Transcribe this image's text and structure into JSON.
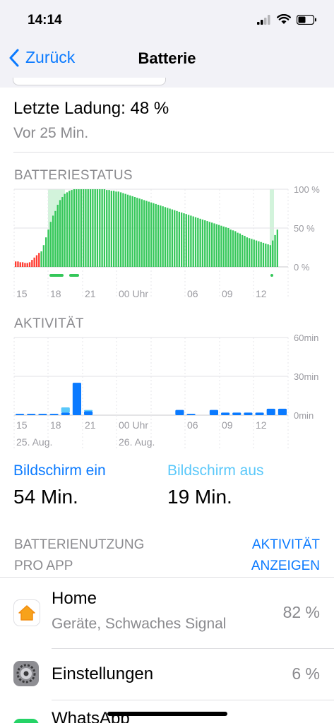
{
  "status": {
    "time": "14:14"
  },
  "nav": {
    "back_label": "Zurück",
    "title": "Batterie"
  },
  "last_charge": {
    "title": "Letzte Ladung: 48 %",
    "subtitle": "Vor 25 Min."
  },
  "battery_status": {
    "label": "BATTERIESTATUS",
    "y_ticks": [
      "100 %",
      "50 %",
      "0 %"
    ],
    "x_ticks": [
      "15",
      "18",
      "21",
      "00 Uhr",
      "06",
      "09",
      "12"
    ]
  },
  "activity": {
    "label": "AKTIVITÄT",
    "y_ticks": [
      "60min",
      "30min",
      "0min"
    ],
    "x_ticks": [
      "15",
      "18",
      "21",
      "00 Uhr",
      "06",
      "09",
      "12"
    ],
    "date_labels": [
      "25. Aug.",
      "26. Aug."
    ]
  },
  "screen": {
    "on_label": "Bildschirm ein",
    "on_value": "54 Min.",
    "off_label": "Bildschirm aus",
    "off_value": "19 Min."
  },
  "usage": {
    "header_line1": "BATTERIENUTZUNG",
    "header_line2": "PRO APP",
    "link_line1": "AKTIVITÄT",
    "link_line2": "ANZEIGEN",
    "apps": [
      {
        "name": "Home",
        "subtitle": "Geräte, Schwaches Signal",
        "percent": "82 %",
        "icon": "home-app-icon"
      },
      {
        "name": "Einstellungen",
        "subtitle": "",
        "percent": "6 %",
        "icon": "settings-app-icon"
      },
      {
        "name": "WhatsApp",
        "subtitle": "",
        "percent": "",
        "icon": "whatsapp-app-icon"
      }
    ]
  },
  "colors": {
    "accent": "#0a7aff",
    "battery_green": "#34c759",
    "battery_low": "#ff3b30",
    "screen_on": "#0a7aff",
    "screen_off": "#5ac8fa"
  },
  "chart_data": [
    {
      "type": "bar",
      "title": "BATTERIESTATUS",
      "ylim": [
        0,
        100
      ],
      "y_unit": "%",
      "x_tick_labels": [
        "15",
        "18",
        "21",
        "00 Uhr",
        "06",
        "09",
        "12"
      ],
      "series": [
        {
          "values": [
            7,
            7,
            6,
            6,
            5,
            5,
            6,
            9,
            12,
            15,
            18,
            20,
            28,
            38,
            48,
            58,
            66,
            72,
            80,
            86,
            90,
            94,
            96,
            98,
            99,
            100,
            100,
            100,
            100,
            100,
            100,
            100,
            100,
            100,
            100,
            100,
            100,
            100,
            100,
            99,
            99,
            98,
            98,
            97,
            97,
            96,
            95,
            94,
            93,
            92,
            91,
            90,
            89,
            88,
            87,
            86,
            85,
            84,
            83,
            82,
            81,
            80,
            79,
            78,
            77,
            76,
            75,
            74,
            73,
            72,
            71,
            70,
            69,
            68,
            67,
            66,
            65,
            64,
            63,
            62,
            61,
            60,
            59,
            58,
            57,
            56,
            55,
            54,
            53,
            52,
            51,
            50,
            48,
            47,
            46,
            44,
            43,
            41,
            40,
            38,
            37,
            36,
            35,
            34,
            33,
            32,
            31,
            30,
            29,
            28,
            34,
            41,
            48
          ]
        }
      ]
    },
    {
      "type": "bar",
      "title": "AKTIVITÄT",
      "ylim": [
        0,
        60
      ],
      "y_unit": "min",
      "x_tick_labels": [
        "15",
        "18",
        "21",
        "00 Uhr",
        "06",
        "09",
        "12"
      ],
      "series": [
        {
          "name": "Bildschirm ein",
          "values": [
            1,
            1,
            1,
            1,
            2,
            25,
            3,
            0,
            0,
            0,
            0,
            0,
            0,
            0,
            4,
            1,
            0,
            4,
            2,
            2,
            2,
            2,
            5,
            5
          ]
        },
        {
          "name": "Bildschirm aus",
          "values": [
            0,
            0,
            0,
            0,
            4,
            0,
            1,
            0,
            0,
            0,
            0,
            0,
            0,
            0,
            0,
            0,
            0,
            0,
            0,
            0,
            0,
            0,
            0,
            0
          ]
        }
      ]
    }
  ]
}
